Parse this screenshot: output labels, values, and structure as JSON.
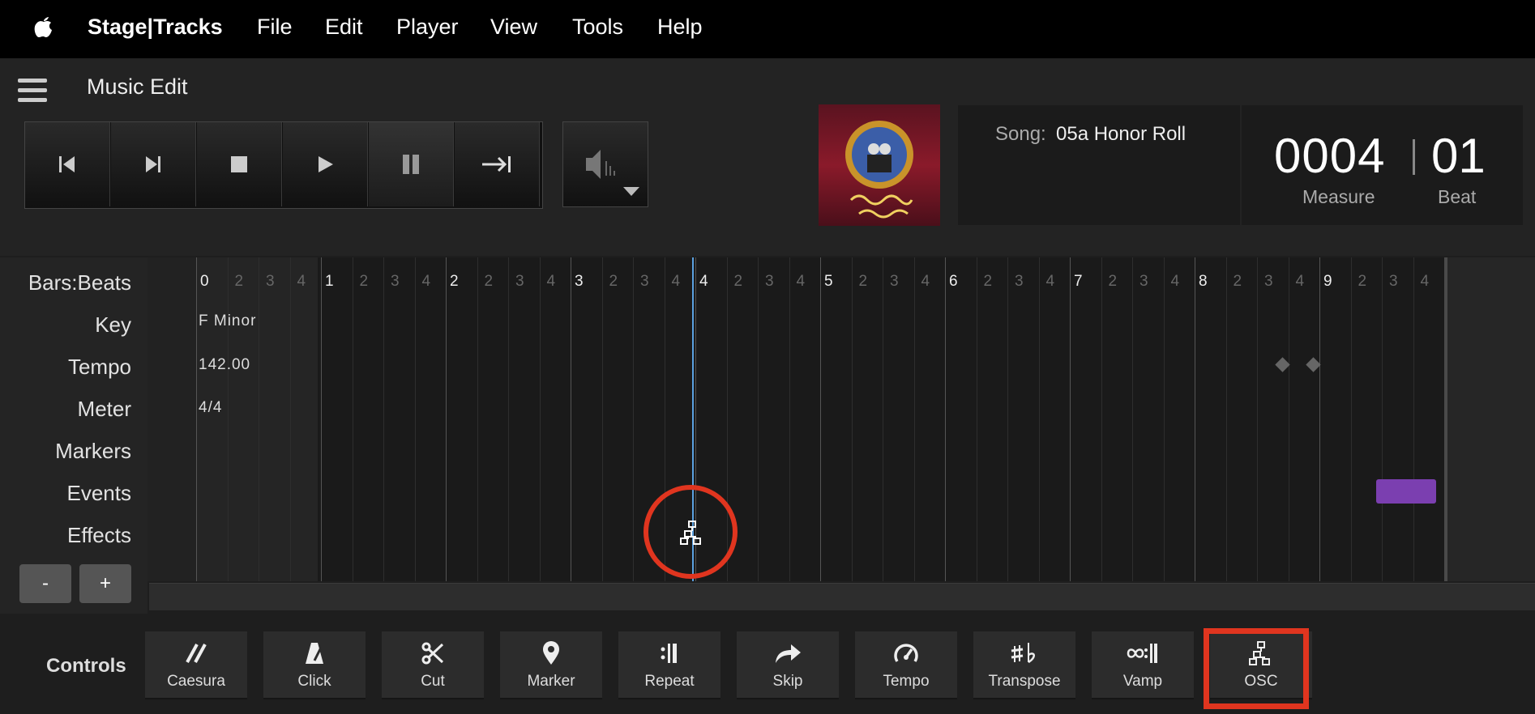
{
  "menubar": {
    "app_name": "Stage|Tracks",
    "items": [
      "File",
      "Edit",
      "Player",
      "View",
      "Tools",
      "Help"
    ]
  },
  "header": {
    "page_title": "Music Edit"
  },
  "transport": {
    "buttons": [
      "skip-to-start",
      "next",
      "stop",
      "play",
      "pause",
      "skip-to-end"
    ]
  },
  "song": {
    "label": "Song:",
    "name": "05a Honor Roll"
  },
  "position": {
    "measure": "0004",
    "beat": "01",
    "measure_label": "Measure",
    "beat_label": "Beat"
  },
  "row_labels": [
    "Bars:Beats",
    "Key",
    "Tempo",
    "Meter",
    "Markers",
    "Events",
    "Effects"
  ],
  "timeline": {
    "bars": [
      "0",
      "1",
      "2",
      "3",
      "4",
      "5",
      "6",
      "7",
      "8",
      "9"
    ],
    "beats": [
      "2",
      "3",
      "4"
    ],
    "key": "F Minor",
    "tempo": "142.00",
    "meter": "4/4",
    "playhead": "4"
  },
  "zoom": {
    "minus": "-",
    "plus": "+"
  },
  "controls": {
    "title": "Controls",
    "buttons": [
      {
        "label": "Caesura",
        "icon": "caesura-icon"
      },
      {
        "label": "Click",
        "icon": "metronome-icon"
      },
      {
        "label": "Cut",
        "icon": "scissors-icon"
      },
      {
        "label": "Marker",
        "icon": "map-pin-icon"
      },
      {
        "label": "Repeat",
        "icon": "repeat-sign-icon"
      },
      {
        "label": "Skip",
        "icon": "forward-arrow-icon"
      },
      {
        "label": "Tempo",
        "icon": "gauge-icon"
      },
      {
        "label": "Transpose",
        "icon": "sharp-flat-icon"
      },
      {
        "label": "Vamp",
        "icon": "vamp-icon"
      },
      {
        "label": "OSC",
        "icon": "network-icon"
      }
    ]
  },
  "colors": {
    "highlight": "#e0351f",
    "playhead": "#5aa0e0",
    "event": "#7b3fb0"
  }
}
